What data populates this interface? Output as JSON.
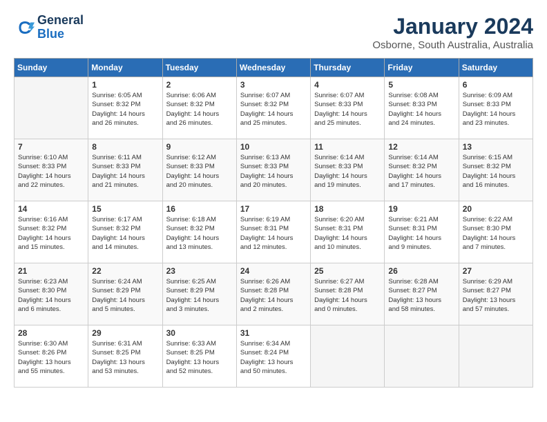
{
  "logo": {
    "line1": "General",
    "line2": "Blue"
  },
  "title": "January 2024",
  "location": "Osborne, South Australia, Australia",
  "weekdays": [
    "Sunday",
    "Monday",
    "Tuesday",
    "Wednesday",
    "Thursday",
    "Friday",
    "Saturday"
  ],
  "weeks": [
    [
      {
        "day": "",
        "info": ""
      },
      {
        "day": "1",
        "info": "Sunrise: 6:05 AM\nSunset: 8:32 PM\nDaylight: 14 hours\nand 26 minutes."
      },
      {
        "day": "2",
        "info": "Sunrise: 6:06 AM\nSunset: 8:32 PM\nDaylight: 14 hours\nand 26 minutes."
      },
      {
        "day": "3",
        "info": "Sunrise: 6:07 AM\nSunset: 8:32 PM\nDaylight: 14 hours\nand 25 minutes."
      },
      {
        "day": "4",
        "info": "Sunrise: 6:07 AM\nSunset: 8:33 PM\nDaylight: 14 hours\nand 25 minutes."
      },
      {
        "day": "5",
        "info": "Sunrise: 6:08 AM\nSunset: 8:33 PM\nDaylight: 14 hours\nand 24 minutes."
      },
      {
        "day": "6",
        "info": "Sunrise: 6:09 AM\nSunset: 8:33 PM\nDaylight: 14 hours\nand 23 minutes."
      }
    ],
    [
      {
        "day": "7",
        "info": "Sunrise: 6:10 AM\nSunset: 8:33 PM\nDaylight: 14 hours\nand 22 minutes."
      },
      {
        "day": "8",
        "info": "Sunrise: 6:11 AM\nSunset: 8:33 PM\nDaylight: 14 hours\nand 21 minutes."
      },
      {
        "day": "9",
        "info": "Sunrise: 6:12 AM\nSunset: 8:33 PM\nDaylight: 14 hours\nand 20 minutes."
      },
      {
        "day": "10",
        "info": "Sunrise: 6:13 AM\nSunset: 8:33 PM\nDaylight: 14 hours\nand 20 minutes."
      },
      {
        "day": "11",
        "info": "Sunrise: 6:14 AM\nSunset: 8:33 PM\nDaylight: 14 hours\nand 19 minutes."
      },
      {
        "day": "12",
        "info": "Sunrise: 6:14 AM\nSunset: 8:32 PM\nDaylight: 14 hours\nand 17 minutes."
      },
      {
        "day": "13",
        "info": "Sunrise: 6:15 AM\nSunset: 8:32 PM\nDaylight: 14 hours\nand 16 minutes."
      }
    ],
    [
      {
        "day": "14",
        "info": "Sunrise: 6:16 AM\nSunset: 8:32 PM\nDaylight: 14 hours\nand 15 minutes."
      },
      {
        "day": "15",
        "info": "Sunrise: 6:17 AM\nSunset: 8:32 PM\nDaylight: 14 hours\nand 14 minutes."
      },
      {
        "day": "16",
        "info": "Sunrise: 6:18 AM\nSunset: 8:32 PM\nDaylight: 14 hours\nand 13 minutes."
      },
      {
        "day": "17",
        "info": "Sunrise: 6:19 AM\nSunset: 8:31 PM\nDaylight: 14 hours\nand 12 minutes."
      },
      {
        "day": "18",
        "info": "Sunrise: 6:20 AM\nSunset: 8:31 PM\nDaylight: 14 hours\nand 10 minutes."
      },
      {
        "day": "19",
        "info": "Sunrise: 6:21 AM\nSunset: 8:31 PM\nDaylight: 14 hours\nand 9 minutes."
      },
      {
        "day": "20",
        "info": "Sunrise: 6:22 AM\nSunset: 8:30 PM\nDaylight: 14 hours\nand 7 minutes."
      }
    ],
    [
      {
        "day": "21",
        "info": "Sunrise: 6:23 AM\nSunset: 8:30 PM\nDaylight: 14 hours\nand 6 minutes."
      },
      {
        "day": "22",
        "info": "Sunrise: 6:24 AM\nSunset: 8:29 PM\nDaylight: 14 hours\nand 5 minutes."
      },
      {
        "day": "23",
        "info": "Sunrise: 6:25 AM\nSunset: 8:29 PM\nDaylight: 14 hours\nand 3 minutes."
      },
      {
        "day": "24",
        "info": "Sunrise: 6:26 AM\nSunset: 8:28 PM\nDaylight: 14 hours\nand 2 minutes."
      },
      {
        "day": "25",
        "info": "Sunrise: 6:27 AM\nSunset: 8:28 PM\nDaylight: 14 hours\nand 0 minutes."
      },
      {
        "day": "26",
        "info": "Sunrise: 6:28 AM\nSunset: 8:27 PM\nDaylight: 13 hours\nand 58 minutes."
      },
      {
        "day": "27",
        "info": "Sunrise: 6:29 AM\nSunset: 8:27 PM\nDaylight: 13 hours\nand 57 minutes."
      }
    ],
    [
      {
        "day": "28",
        "info": "Sunrise: 6:30 AM\nSunset: 8:26 PM\nDaylight: 13 hours\nand 55 minutes."
      },
      {
        "day": "29",
        "info": "Sunrise: 6:31 AM\nSunset: 8:25 PM\nDaylight: 13 hours\nand 53 minutes."
      },
      {
        "day": "30",
        "info": "Sunrise: 6:33 AM\nSunset: 8:25 PM\nDaylight: 13 hours\nand 52 minutes."
      },
      {
        "day": "31",
        "info": "Sunrise: 6:34 AM\nSunset: 8:24 PM\nDaylight: 13 hours\nand 50 minutes."
      },
      {
        "day": "",
        "info": ""
      },
      {
        "day": "",
        "info": ""
      },
      {
        "day": "",
        "info": ""
      }
    ]
  ]
}
